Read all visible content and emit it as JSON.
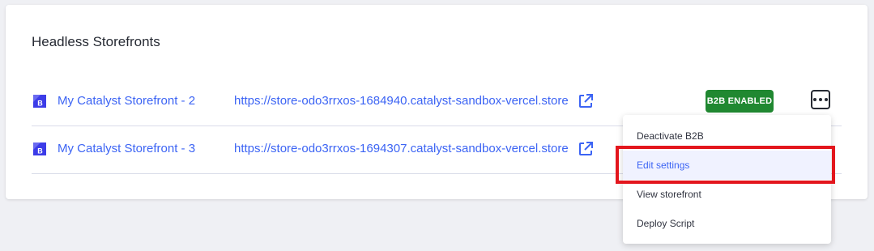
{
  "section": {
    "title": "Headless Storefronts"
  },
  "storefronts": [
    {
      "name": "My Catalyst Storefront - 2",
      "url": "https://store-odo3rrxos-1684940.catalyst-sandbox-vercel.store",
      "badge": "B2B ENABLED"
    },
    {
      "name": "My Catalyst Storefront - 3",
      "url": "https://store-odo3rrxos-1694307.catalyst-sandbox-vercel.store"
    }
  ],
  "menu": {
    "items": [
      "Deactivate B2B",
      "Edit settings",
      "View storefront",
      "Deploy Script"
    ]
  },
  "colors": {
    "link": "#3c64f4",
    "badge": "#208831",
    "highlight": "#e3161d",
    "brand_icon": "#3c3ce8"
  }
}
